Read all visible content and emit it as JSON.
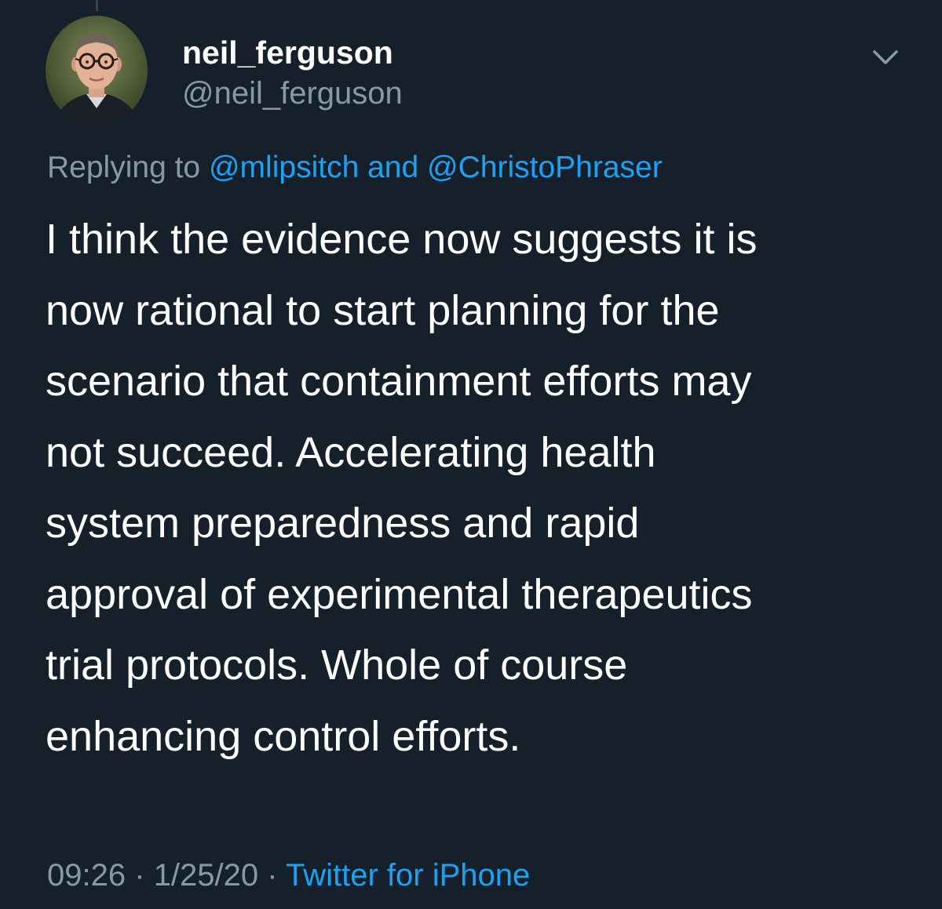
{
  "tweet": {
    "author": {
      "display_name": "neil_ferguson",
      "handle": "@neil_ferguson",
      "avatar_icon": "user-avatar"
    },
    "menu_icon": "chevron-down-icon",
    "replying": {
      "prefix": "Replying to",
      "mention_1": "@mlipsitch",
      "conjunction": "and",
      "mention_2": "@ChristoPhraser"
    },
    "text_lines": [
      "I think the evidence now suggests it is",
      "now rational to start planning for the",
      "scenario that containment efforts may",
      "not succeed. Accelerating health",
      "system preparedness and rapid",
      "approval of experimental therapeutics",
      "trial protocols. Whole of course",
      "enhancing control efforts."
    ],
    "meta": {
      "time": "09:26",
      "separator": "·",
      "date": "1/25/20",
      "source": "Twitter for iPhone"
    }
  },
  "colors": {
    "background": "#15202b",
    "text": "#ffffff",
    "secondary": "#8899a6",
    "accent": "#1da1f2"
  }
}
